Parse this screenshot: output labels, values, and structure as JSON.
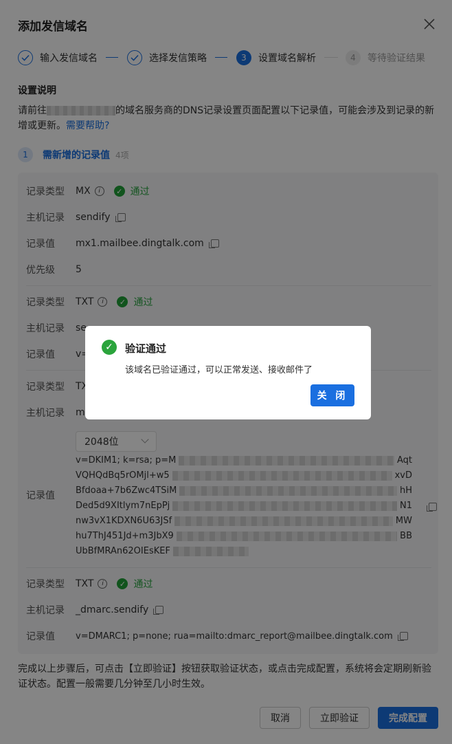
{
  "title": "添加发信域名",
  "steps": [
    {
      "index": "✓",
      "label": "输入发信域名",
      "state": "done"
    },
    {
      "index": "✓",
      "label": "选择发信策略",
      "state": "done"
    },
    {
      "index": "3",
      "label": "设置域名解析",
      "state": "current"
    },
    {
      "index": "4",
      "label": "等待验证结果",
      "state": "todo"
    }
  ],
  "setup": {
    "heading": "设置说明",
    "desc_prefix": "请前往",
    "desc_suffix": "的域名服务商的DNS记录设置页面配置以下记录值，可能会涉及到记录的新增或更新。",
    "help_link": "需要帮助?"
  },
  "section": {
    "num": "1",
    "label": "需新增的记录值",
    "count": "4项"
  },
  "labels": {
    "type": "记录类型",
    "host": "主机记录",
    "value": "记录值",
    "priority": "优先级",
    "passed": "通过"
  },
  "records": [
    {
      "type": "MX",
      "host": "sendify",
      "value": "mx1.mailbee.dingtalk.com",
      "priority": "5"
    },
    {
      "type": "TXT",
      "host": "se",
      "value": "v="
    },
    {
      "type": "TX",
      "host": "ma",
      "key_size": "2048位",
      "dkim_lines": [
        {
          "start": "v=DKIM1; k=rsa; p=M",
          "end": "Aqt"
        },
        {
          "start": "VQHQdBq5rOMjl+w5",
          "end": "xvD"
        },
        {
          "start": "Bfdoaa+7b6Zwc4TSiM",
          "end": "hH"
        },
        {
          "start": "Ded5d9XItlym7nEpPj",
          "end": "N1"
        },
        {
          "start": "nw3vX1KDXN6U63JSf",
          "end": "MW"
        },
        {
          "start": "hu7ThJ451Jd+m3JbX9",
          "end": "BB"
        },
        {
          "start": "UbBfMRAn62OIEsKEF",
          "end": ""
        }
      ]
    },
    {
      "type": "TXT",
      "host": "_dmarc.sendify",
      "value": "v=DMARC1; p=none; rua=mailto:dmarc_report@mailbee.dingtalk.com"
    }
  ],
  "footnote": "完成以上步骤后，可点击【立即验证】按钮获取验证状态，或点击完成配置，系统将会定期刷新验证状态。配置一般需要几分钟至几小时生效。",
  "buttons": {
    "cancel": "取消",
    "verify": "立即验证",
    "finish": "完成配置"
  },
  "dialog": {
    "title": "验证通过",
    "message": "该域名已验证通过，可以正常发送、接收邮件了",
    "close": "关 闭"
  },
  "colors": {
    "primary": "#1a6fe0",
    "success": "#21a138"
  }
}
